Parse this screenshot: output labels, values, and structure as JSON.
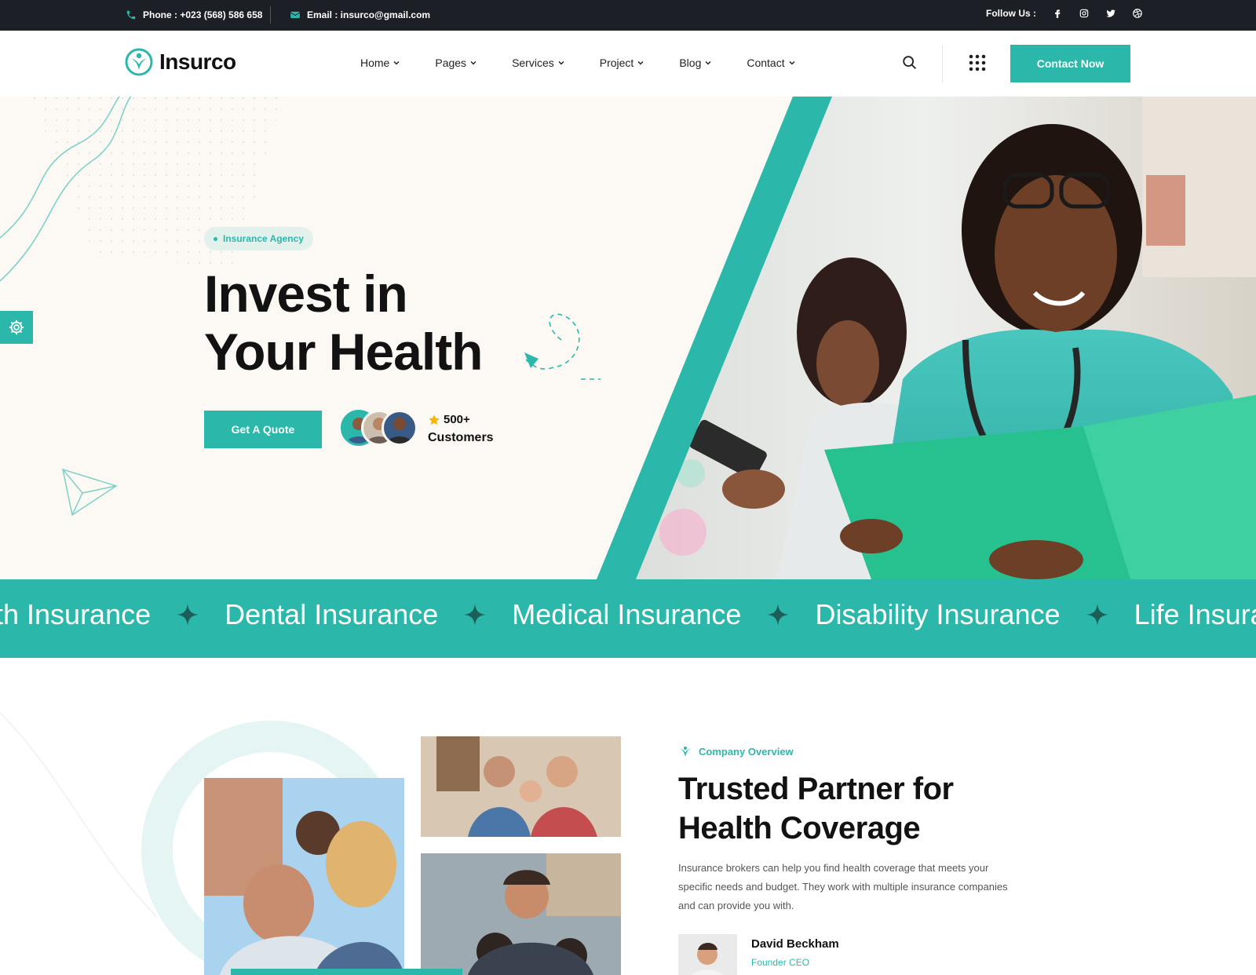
{
  "topbar": {
    "phone": "Phone : +023 (568) 586 658",
    "email": "Email : insurco@gmail.com",
    "follow": "Follow Us :"
  },
  "header": {
    "logo": "Insurco",
    "nav": [
      "Home",
      "Pages",
      "Services",
      "Project",
      "Blog",
      "Contact"
    ],
    "cta": "Contact Now"
  },
  "hero": {
    "badge": "Insurance Agency",
    "title_line1": "Invest in",
    "title_line2": "Your Health",
    "button": "Get A Quote",
    "customers_count": "500+",
    "customers_label": "Customers"
  },
  "ticker": [
    "th Insurance",
    "Dental Insurance",
    "Medical Insurance",
    "Disability Insurance",
    "Life Insurance"
  ],
  "about": {
    "tag": "Company Overview",
    "title_line1": "Trusted Partner for",
    "title_line2": "Health Coverage",
    "text": "Insurance brokers can help you find health coverage that meets your specific needs and budget. They work with multiple insurance companies and can provide you with.",
    "person_name": "David Beckham",
    "person_role": "Founder CEO"
  },
  "colors": {
    "accent": "#2bb8ab",
    "dark": "#1d1f26",
    "hero_bg": "#fcf8f4"
  },
  "icons": [
    "phone-icon",
    "mail-icon",
    "facebook-icon",
    "instagram-icon",
    "twitter-icon",
    "dribbble-icon",
    "search-icon",
    "grid-menu-icon",
    "settings-icon",
    "star-icon",
    "sparkle-icon"
  ]
}
